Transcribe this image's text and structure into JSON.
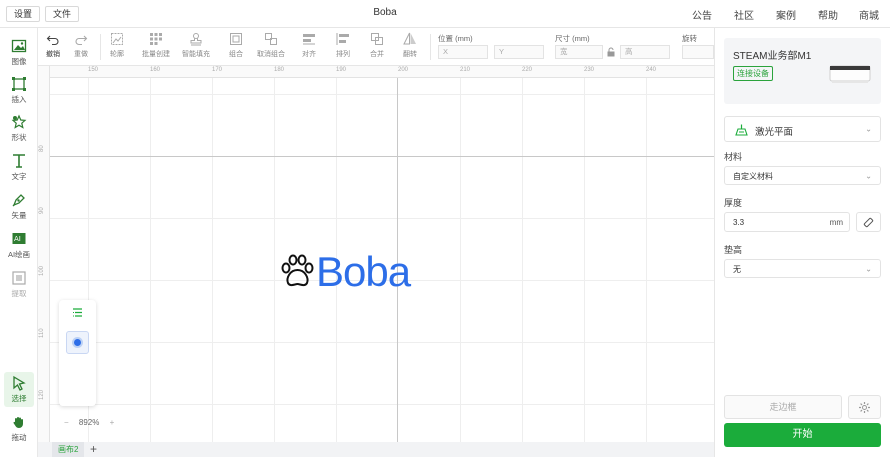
{
  "topbar": {
    "settings_label": "设置",
    "file_label": "文件",
    "title": "Boba",
    "nav": [
      "公告",
      "社区",
      "案例",
      "帮助",
      "商城"
    ]
  },
  "leftbar": {
    "tools": [
      {
        "label": "图像",
        "icon": "image-icon"
      },
      {
        "label": "插入",
        "icon": "insert-icon"
      },
      {
        "label": "形状",
        "icon": "shape-icon"
      },
      {
        "label": "文字",
        "icon": "text-icon"
      },
      {
        "label": "矢量",
        "icon": "pen-icon"
      },
      {
        "label": "AI绘画",
        "icon": "ai-paint-icon"
      },
      {
        "label": "提取",
        "icon": "extract-icon"
      },
      {
        "label": "选择",
        "icon": "select-cursor-icon"
      },
      {
        "label": "拖动",
        "icon": "hand-icon"
      }
    ]
  },
  "toolbar": {
    "undo": "撤销",
    "redo": "重做",
    "outline": "轮廓",
    "batch": "批量创建",
    "smart_fill": "智能填充",
    "group": "组合",
    "ungroup": "取消组合",
    "align": "对齐",
    "arrange": "排列",
    "merge": "合并",
    "flip": "翻转",
    "position_label": "位置 (mm)",
    "x_placeholder": "X",
    "y_placeholder": "Y",
    "size_label": "尺寸 (mm)",
    "w_placeholder": "宽",
    "h_placeholder": "高",
    "rotate_label": "旋转"
  },
  "ruler": {
    "h_ticks": [
      "150",
      "160",
      "170",
      "180",
      "190",
      "200",
      "210",
      "220",
      "230",
      "240"
    ],
    "v_ticks": [
      "80",
      "90",
      "100",
      "110",
      "120",
      "130",
      "140"
    ]
  },
  "canvas": {
    "text": "Boba",
    "text_color": "#2d6ee8"
  },
  "zoom": {
    "minus": "−",
    "value": "892%",
    "plus": "+"
  },
  "tabs": {
    "current": "画布2",
    "add": "+"
  },
  "right": {
    "device_name": "STEAM业务部M1",
    "connect_label": "连接设备",
    "mode_label": "激光平面",
    "material_label": "材料",
    "material_value": "自定义材料",
    "thickness_label": "厚度",
    "thickness_value": "3.3",
    "thickness_unit": "mm",
    "riser_label": "垫高",
    "riser_value": "无",
    "frame_button": "走边框",
    "start_button": "开始",
    "accent_color": "#1bac3b"
  }
}
